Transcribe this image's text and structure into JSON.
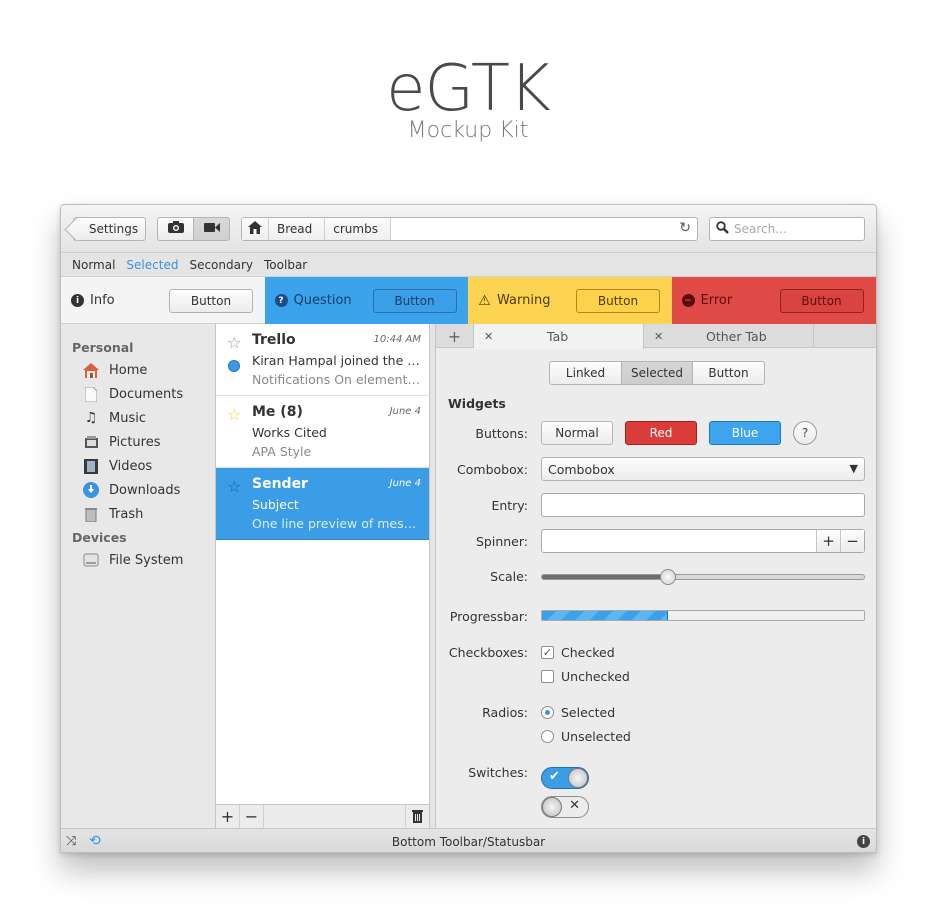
{
  "hero": {
    "title": "eGTK",
    "subtitle": "Mockup Kit"
  },
  "headerbar": {
    "back_label": "Settings",
    "camera_icon": "camera-icon",
    "video_icon": "video-camera-icon",
    "breadcrumbs": [
      "Bread",
      "crumbs"
    ],
    "search_placeholder": "Search..."
  },
  "toolbar": {
    "items": [
      "Normal",
      "Selected",
      "Secondary",
      "Toolbar"
    ],
    "selected_index": 1
  },
  "infobars": [
    {
      "kind": "info",
      "label": "Info",
      "button": "Button",
      "color": "#f4f4f4"
    },
    {
      "kind": "question",
      "label": "Question",
      "button": "Button",
      "color": "#3ba3ec"
    },
    {
      "kind": "warning",
      "label": "Warning",
      "button": "Button",
      "color": "#fdd352"
    },
    {
      "kind": "error",
      "label": "Error",
      "button": "Button",
      "color": "#e04a46"
    }
  ],
  "sidebar": {
    "personal_heading": "Personal",
    "items": [
      {
        "label": "Home",
        "icon": "home-icon"
      },
      {
        "label": "Documents",
        "icon": "document-icon"
      },
      {
        "label": "Music",
        "icon": "music-note-icon"
      },
      {
        "label": "Pictures",
        "icon": "pictures-icon"
      },
      {
        "label": "Videos",
        "icon": "film-icon"
      },
      {
        "label": "Downloads",
        "icon": "download-icon"
      },
      {
        "label": "Trash",
        "icon": "trash-icon"
      }
    ],
    "devices_heading": "Devices",
    "devices": [
      {
        "label": "File System",
        "icon": "drive-icon"
      }
    ]
  },
  "messages": [
    {
      "sender": "Trello",
      "time": "10:44 AM",
      "subject": "Kiran Hampal joined the car...",
      "preview": "Notifications On elementar...",
      "unread": true,
      "starred": false,
      "selected": false
    },
    {
      "sender": "Me (8)",
      "time": "June 4",
      "subject": "Works Cited",
      "preview": "APA Style",
      "unread": false,
      "starred": true,
      "selected": false
    },
    {
      "sender": "Sender",
      "time": "June 4",
      "subject": "Subject",
      "preview": "One line preview of messag...",
      "unread": false,
      "starred": false,
      "selected": true
    }
  ],
  "tabs": {
    "active": "Tab",
    "other": "Other Tab"
  },
  "linked": [
    "Linked",
    "Selected",
    "Button"
  ],
  "widgets": {
    "title": "Widgets",
    "buttons_label": "Buttons:",
    "btn_normal": "Normal",
    "btn_red": "Red",
    "btn_blue": "Blue",
    "help": "?",
    "combobox_label": "Combobox:",
    "combobox_value": "Combobox",
    "entry_label": "Entry:",
    "entry_value": "",
    "spinner_label": "Spinner:",
    "spinner_value": "",
    "scale_label": "Scale:",
    "scale_value": 0.39,
    "progress_label": "Progressbar:",
    "progress_value": 0.39,
    "checkboxes_label": "Checkboxes:",
    "checked": "Checked",
    "unchecked": "Unchecked",
    "radios_label": "Radios:",
    "radio_selected": "Selected",
    "radio_unselected": "Unselected",
    "switches_label": "Switches:"
  },
  "statusbar": {
    "text": "Bottom Toolbar/Statusbar"
  },
  "colors": {
    "accent": "#3893e0",
    "red": "#dc3c38",
    "blue": "#3ca5ee"
  }
}
